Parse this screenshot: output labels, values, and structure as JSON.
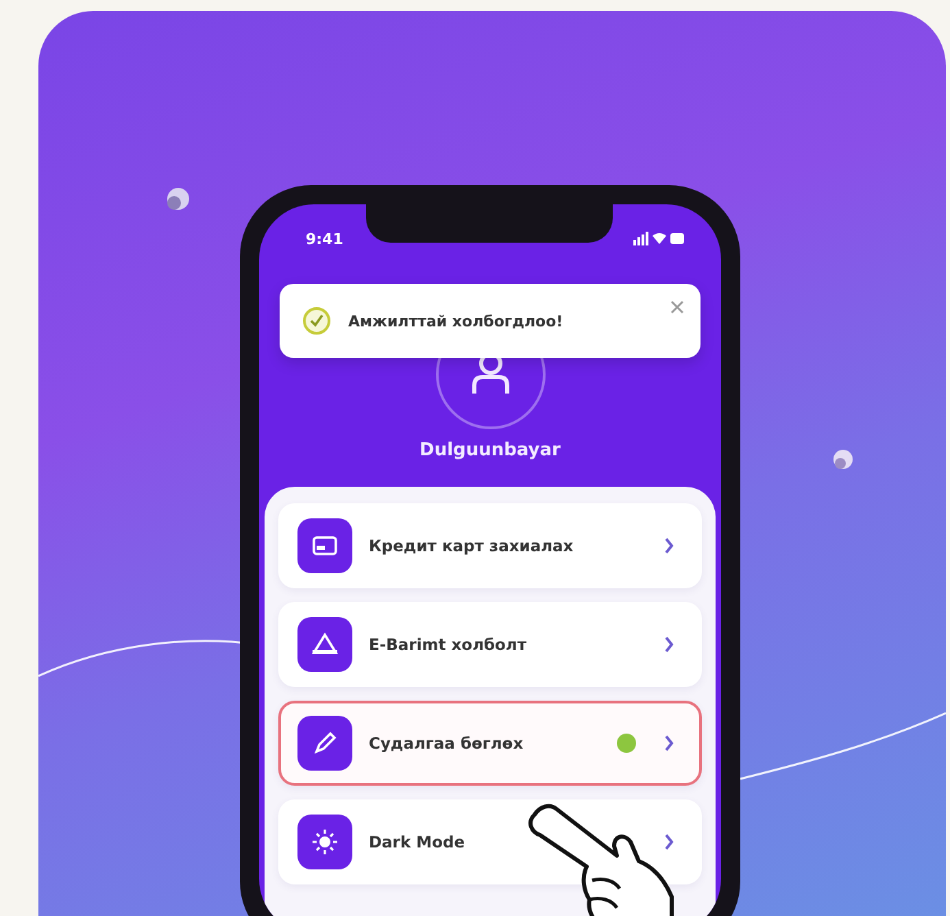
{
  "status_bar": {
    "time": "9:41"
  },
  "toast": {
    "message": "Амжилттай холбогдлоо!"
  },
  "profile": {
    "name": "Dulguunbayar"
  },
  "menu": [
    {
      "label": "Кредит карт захиалах",
      "kind": "card",
      "selected": false,
      "badge": false
    },
    {
      "label": "E-Barimt холболт",
      "kind": "receipt",
      "selected": false,
      "badge": false
    },
    {
      "label": "Судалгаа бөглөх",
      "kind": "pen",
      "selected": true,
      "badge": true
    },
    {
      "label": "Dark Mode",
      "kind": "sun",
      "selected": false,
      "badge": false
    }
  ]
}
